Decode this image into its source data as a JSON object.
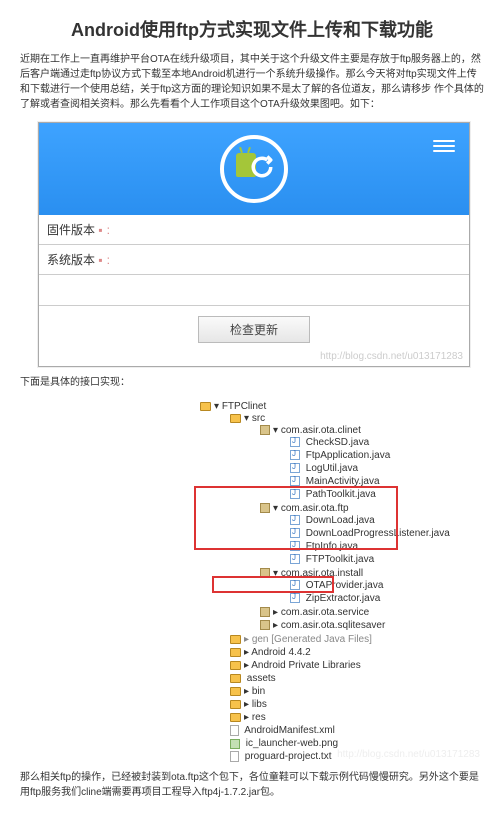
{
  "title": "Android使用ftp方式实现文件上传和下载功能",
  "intro": "近期在工作上一直再维护平台OTA在线升级项目，其中关于这个升级文件主要是存放于ftp服务器上的，然后客户端通过走ftp协议方式下载至本地Android机进行一个系统升级操作。那么今天将对ftp实现文件上传和下载进行一个使用总结，关于ftp这方面的理论知识如果不是太了解的各位道友，那么请移步 作个具体的了解或者查阅相关资料。那么先看看个人工作项目这个OTA升级效果图吧。如下：",
  "phone": {
    "firmware_label": "固件版本 ",
    "system_label": "系统版本 ",
    "check_btn": "检查更新",
    "watermark": "http://blog.csdn.net/u013171283"
  },
  "section2": "下面是具体的接口实现：",
  "tree": {
    "root": "FTPClinet",
    "src": "src",
    "pkg_clinet": "com.asir.ota.clinet",
    "files_clinet": [
      "CheckSD.java",
      "FtpApplication.java",
      "LogUtil.java",
      "MainActivity.java",
      "PathToolkit.java"
    ],
    "pkg_ftp": "com.asir.ota.ftp",
    "files_ftp": [
      "DownLoad.java",
      "DownLoadProgressListener.java",
      "FtpInfo.java",
      "FTPToolkit.java"
    ],
    "pkg_install": "com.asir.ota.install",
    "files_install": [
      "OTAProvider.java",
      "ZipExtractor.java"
    ],
    "pkg_service": "com.asir.ota.service",
    "pkg_sqlite": "com.asir.ota.sqlitesaver",
    "gen": "gen [Generated Java Files]",
    "android": "Android 4.4.2",
    "priv": "Android Private Libraries",
    "assets": "assets",
    "bin": "bin",
    "libs": "libs",
    "res": "res",
    "manifest": "AndroidManifest.xml",
    "launcher": "ic_launcher-web.png",
    "proguard": "proguard-project.txt",
    "watermark": "http://blog.csdn.net/u013171283"
  },
  "outro": "那么相关ftp的操作，已经被封装到ota.ftp这个包下，各位童鞋可以下载示例代码慢慢研究。另外这个要是用ftp服务我们cline端需要再项目工程导入ftp4j-1.7.2.jar包。"
}
